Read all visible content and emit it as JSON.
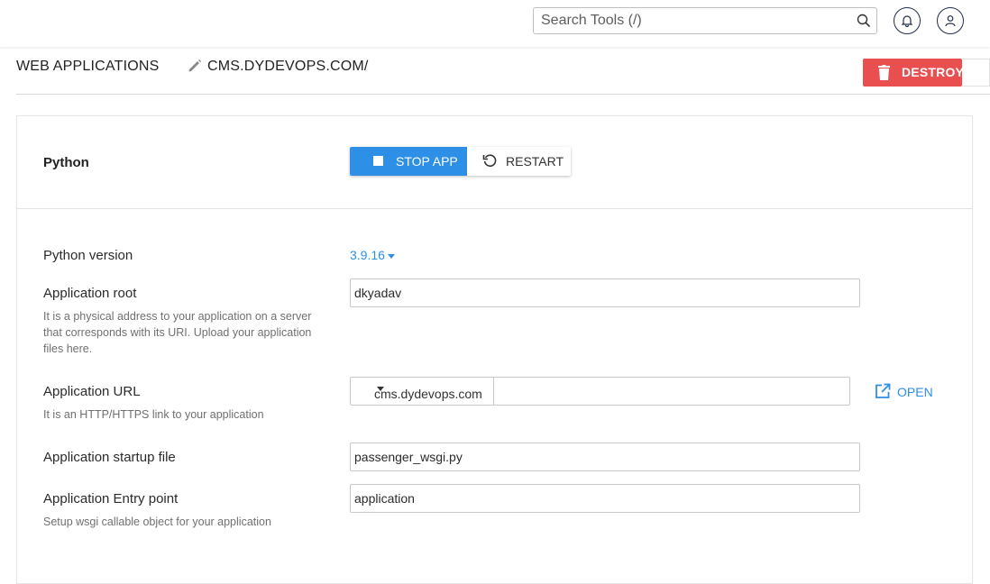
{
  "header": {
    "search_placeholder": "Search Tools (/)",
    "icons": [
      "search-icon",
      "bell-icon",
      "user-icon"
    ]
  },
  "tabs": {
    "web_applications": "WEB APPLICATIONS",
    "current_app": "CMS.DYDEVOPS.COM/"
  },
  "destroy_button": "DESTROY",
  "panel": {
    "title": "Python",
    "stop_app": "STOP APP",
    "restart": "RESTART"
  },
  "form": {
    "python_version_label": "Python version",
    "python_version_value": "3.9.16",
    "app_root_label": "Application root",
    "app_root_hint": "It is a physical address to your application on a server that corresponds with its URI. Upload your application files here.",
    "app_root_value": "dkyadav",
    "app_url_label": "Application URL",
    "app_url_hint": "It is an HTTP/HTTPS link to your application",
    "app_url_domain": "cms.dydevops.com",
    "app_url_path": "",
    "open_link": "OPEN",
    "startup_file_label": "Application startup file",
    "startup_file_value": "passenger_wsgi.py",
    "entry_point_label": "Application Entry point",
    "entry_point_hint": "Setup wsgi callable object for your application",
    "entry_point_value": "application"
  },
  "colors": {
    "accent": "#2d8fe6",
    "danger": "#ea4f4f"
  }
}
